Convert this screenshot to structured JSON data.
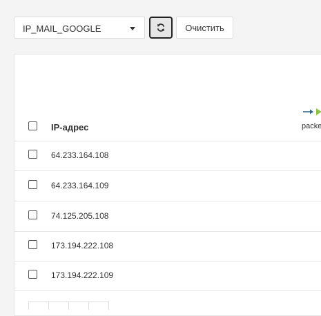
{
  "toolbar": {
    "select_value": "IP_MAIL_GOOGLE",
    "refresh_icon": "refresh-icon",
    "clear_label": "Очистить"
  },
  "table": {
    "column_header": "IP-адрес",
    "packets_label": "packets",
    "packets_icons": [
      "arrow-right-icon",
      "play-icon"
    ],
    "rows": [
      {
        "ip": "64.233.164.108"
      },
      {
        "ip": "64.233.164.109"
      },
      {
        "ip": "74.125.205.108"
      },
      {
        "ip": "173.194.222.108"
      },
      {
        "ip": "173.194.222.109"
      }
    ]
  },
  "colors": {
    "accent_arrow": "#2e6b8a",
    "play_green": "#8bc34a"
  }
}
